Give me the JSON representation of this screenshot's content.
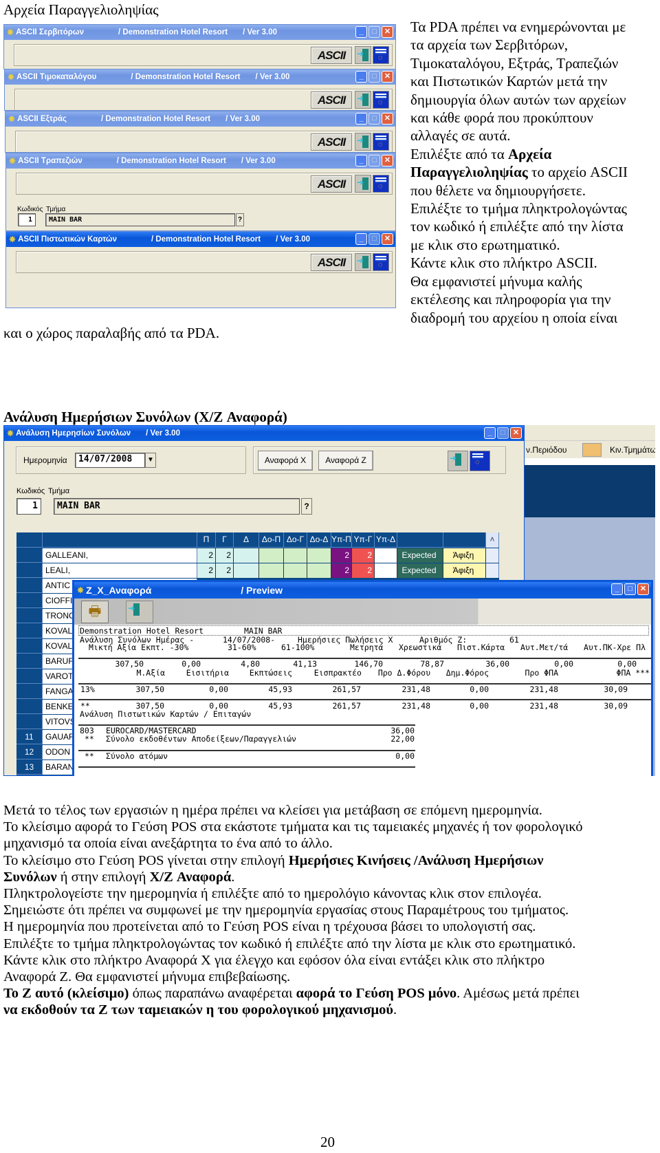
{
  "section1": {
    "heading": "Αρχεία Παραγγελιοληψίας",
    "windows": [
      {
        "title": "ASCII Σερβιτόρων",
        "company": "/ Demonstration Hotel Resort",
        "version": "/  Ver  3.00",
        "button": "ASCII",
        "active": false
      },
      {
        "title": "ASCII Τιμοκαταλόγου",
        "company": "/ Demonstration Hotel Resort",
        "version": "/  Ver  3.00",
        "button": "ASCII",
        "active": false
      },
      {
        "title": "ASCII Εξτράς",
        "company": "/ Demonstration Hotel Resort",
        "version": "/  Ver  3.00",
        "button": "ASCII",
        "active": false
      },
      {
        "title": "ASCII Τραπεζιών",
        "company": "/ Demonstration Hotel Resort",
        "version": "/  Ver  3.00",
        "button": "ASCII",
        "active": false
      },
      {
        "title": "ASCII Πιστωτικών Καρτών",
        "company": "/ Demonstration Hotel Resort",
        "version": "/  Ver  3.00",
        "button": "ASCII",
        "active": true
      }
    ],
    "dept_form": {
      "code_label": "Κωδικός",
      "dept_label": "Τμήμα",
      "code": "1",
      "dept": "MAIN BAR",
      "lookup": "?"
    },
    "right_text": [
      [
        {
          "t": "Τα PDA πρέπει να ενημερώνονται με"
        }
      ],
      [
        {
          "t": "τα αρχεία των Σερβιτόρων,"
        }
      ],
      [
        {
          "t": "Τιμοκαταλόγου, Εξτράς, Τραπεζιών"
        }
      ],
      [
        {
          "t": "και Πιστωτικών Καρτών μετά την"
        }
      ],
      [
        {
          "t": "δημιουργία όλων αυτών των αρχείων"
        }
      ],
      [
        {
          "t": "και κάθε φορά που προκύπτουν"
        }
      ],
      [
        {
          "t": "αλλαγές σε αυτά."
        }
      ],
      [
        {
          "t": "Επιλέξτε από τα "
        },
        {
          "t": "Αρχεία",
          "b": true
        }
      ],
      [
        {
          "t": "Παραγγελιοληψίας",
          "b": true
        },
        {
          "t": " το αρχείο ASCII"
        }
      ],
      [
        {
          "t": "που θέλετε να δημιουργήσετε."
        }
      ],
      [
        {
          "t": "Επιλέξτε το τμήμα πληκτρολογώντας"
        }
      ],
      [
        {
          "t": "τον κωδικό ή επιλέξτε από την λίστα"
        }
      ],
      [
        {
          "t": "με κλικ στο ερωτηματικό."
        }
      ],
      [
        {
          "t": "Κάντε κλικ στο πλήκτρο ASCII."
        }
      ],
      [
        {
          "t": "Θα εμφανιστεί μήνυμα καλής"
        }
      ],
      [
        {
          "t": "εκτέλεσης και πληροφορία για την"
        }
      ],
      [
        {
          "t": "διαδρομή του αρχείου η οποία είναι"
        }
      ]
    ],
    "continuation": "και ο χώρος παραλαβής από τα PDA."
  },
  "section2": {
    "heading": "Ανάλυση Ημερήσιων Συνόλων (X/Z Αναφορά)",
    "window": {
      "title": "Ανάλυση Ημερησίων Συνόλων",
      "version": "/  Ver  3.00",
      "date_label": "Ημερομηνία",
      "date": "14/07/2008",
      "report_x": "Αναφορά X",
      "report_z": "Αναφορά Z",
      "code_label": "Κωδικός",
      "dept_label": "Τμήμα",
      "code": "1",
      "dept": "MAIN BAR",
      "lookup": "?"
    },
    "grid": {
      "columns": [
        "",
        "",
        "Π",
        "Γ",
        "Δ",
        "Δο-Π",
        "Δο-Γ",
        "Δο-Δ",
        "Υπ-Π",
        "Υπ-Γ",
        "Υπ-Δ",
        "",
        ""
      ],
      "rows": [
        {
          "num": "",
          "name": "GALLEANI,",
          "cells": [
            "2",
            "2",
            "",
            "",
            "",
            "",
            "2",
            "2",
            "",
            "Expected",
            "Άφιξη"
          ]
        },
        {
          "num": "",
          "name": "LEALI,",
          "cells": [
            "2",
            "2",
            "",
            "",
            "",
            "",
            "2",
            "2",
            "",
            "Expected",
            "Άφιξη"
          ]
        },
        {
          "num": "",
          "name": "ANTIC",
          "cells": []
        },
        {
          "num": "",
          "name": "CIOFFI",
          "cells": []
        },
        {
          "num": "",
          "name": "TRONC",
          "cells": []
        },
        {
          "num": "",
          "name": "KOVAL",
          "cells": []
        },
        {
          "num": "",
          "name": "KOVAL",
          "cells": []
        },
        {
          "num": "",
          "name": "BARUF",
          "cells": []
        },
        {
          "num": "",
          "name": "VAROT",
          "cells": []
        },
        {
          "num": "",
          "name": "FANGA",
          "cells": []
        },
        {
          "num": "",
          "name": "BENKE",
          "cells": []
        },
        {
          "num": "",
          "name": "VITOVS",
          "cells": []
        },
        {
          "num": "11",
          "name": "GAUAR",
          "cells": []
        },
        {
          "num": "12",
          "name": "ODON",
          "cells": []
        },
        {
          "num": "13",
          "name": "BARAN",
          "cells": []
        }
      ],
      "colors": {
        "header": "#0c4a8a",
        "pi": "#d6f2ee",
        "do": "#d2eec6",
        "yp_p": "#7a1282",
        "yp_g": "#f05252",
        "expected": "#2e6a5c",
        "arrival": "#fff6b0"
      }
    },
    "side_toolbar": {
      "period": "ν.Περιόδου",
      "departments": "Κιν.Τμημάτων"
    },
    "preview": {
      "title": "Z_X_Αναφορά",
      "subtitle": "/ Preview",
      "report": {
        "line1": [
          "Demonstration Hotel Resort",
          "MAIN BAR"
        ],
        "line2": [
          "Ανάλυση Συνόλων Ημέρας -",
          "14/07/2008-",
          "Ημερήσιες Πωλήσεις X",
          "Αριθμός Z:",
          "61"
        ],
        "line3": [
          "Μικτή Αξία Εκπτ. -30%",
          "31-60%",
          "61-100%",
          "Μετρητά",
          "Χρεωστικά",
          "Πιστ.Κάρτα",
          "Αυτ.Μετ/τά",
          "Αυτ.ΠΚ-Χρε Πλ"
        ],
        "totals": [
          "307,50",
          "0,00",
          "4,80",
          "41,13",
          "146,70",
          "78,87",
          "36,00",
          "0,00",
          "0,00"
        ],
        "total_labels": [
          "Μ.Αξία",
          "Εισιτήρια",
          "Εκπτώσεις",
          "Εισπρακτέο",
          "Προ Δ.Φόρου",
          "Δημ.Φόρος",
          "Προ ΦΠΑ",
          "ΦΠΑ ***"
        ],
        "vat_row": [
          "13%",
          "307,50",
          "0,00",
          "45,93",
          "261,57",
          "231,48",
          "0,00",
          "231,48",
          "30,09"
        ],
        "sum_row": [
          "**",
          "307,50",
          "0,00",
          "45,93",
          "261,57",
          "231,48",
          "0,00",
          "231,48",
          "30,09"
        ],
        "cards_heading": "Ανάλυση Πιστωτικών Καρτών / Επιταγών",
        "card_row": [
          "803",
          "EUROCARD/MASTERCARD",
          "36,00"
        ],
        "receipts_row": [
          "**",
          "Σύνολο εκδοθέντων Αποδείξεων/Παραγγελιών",
          "22,00"
        ],
        "persons_row": [
          "**",
          "Σύνολο ατόμων",
          "0,00"
        ]
      }
    }
  },
  "body_text": [
    [
      {
        "t": "Μετά το τέλος των εργασιών η ημέρα πρέπει να κλείσει για μετάβαση σε επόμενη ημερομηνία."
      }
    ],
    [
      {
        "t": "Το κλείσιμο αφορά το Γεύση POS στα εκάστοτε τμήματα και τις ταμειακές μηχανές ή τον φορολογικό"
      }
    ],
    [
      {
        "t": "μηχανισμό τα οποία είναι ανεξάρτητα το ένα από το άλλο."
      }
    ],
    [
      {
        "t": "Το κλείσιμο στο Γεύση POS γίνεται στην επιλογή "
      },
      {
        "t": "Ημερήσιες Κινήσεις /Ανάλυση Ημερήσιων",
        "b": true
      }
    ],
    [
      {
        "t": "Συνόλων",
        "b": true
      },
      {
        "t": " ή στην επιλογή "
      },
      {
        "t": "X/Z Αναφορά",
        "b": true
      },
      {
        "t": "."
      }
    ],
    [
      {
        "t": "Πληκτρολογείστε την ημερομηνία ή επιλέξτε από το ημερολόγιο κάνοντας κλικ στον επιλογέα."
      }
    ],
    [
      {
        "t": "Σημειώστε ότι πρέπει να συμφωνεί με την ημερομηνία εργασίας στους Παραμέτρους του τμήματος."
      }
    ],
    [
      {
        "t": "Η ημερομηνία που προτείνεται από το Γεύση POS είναι η τρέχουσα βάσει το υπολογιστή σας."
      }
    ],
    [
      {
        "t": "Επιλέξτε το τμήμα πληκτρολογώντας τον κωδικό ή επιλέξτε από την λίστα με κλικ στο ερωτηματικό."
      }
    ],
    [
      {
        "t": "Κάντε κλικ στο πλήκτρο Αναφορά X για έλεγχο και εφόσον όλα είναι εντάξει κλικ στο πλήκτρο"
      }
    ],
    [
      {
        "t": "Αναφορά Z. Θα εμφανιστεί μήνυμα επιβεβαίωσης."
      }
    ],
    [
      {
        "t": "Το Z αυτό (κλείσιμο)",
        "b": true
      },
      {
        "t": " όπως παραπάνω αναφέρεται "
      },
      {
        "t": "αφορά το Γεύση POS μόνο",
        "b": true
      },
      {
        "t": ". Αμέσως μετά πρέπει"
      }
    ],
    [
      {
        "t": "να εκδοθούν τα Z των ταμειακών η του φορολογικού μηχανισμού",
        "b": true
      },
      {
        "t": "."
      }
    ]
  ],
  "page_number": "20"
}
